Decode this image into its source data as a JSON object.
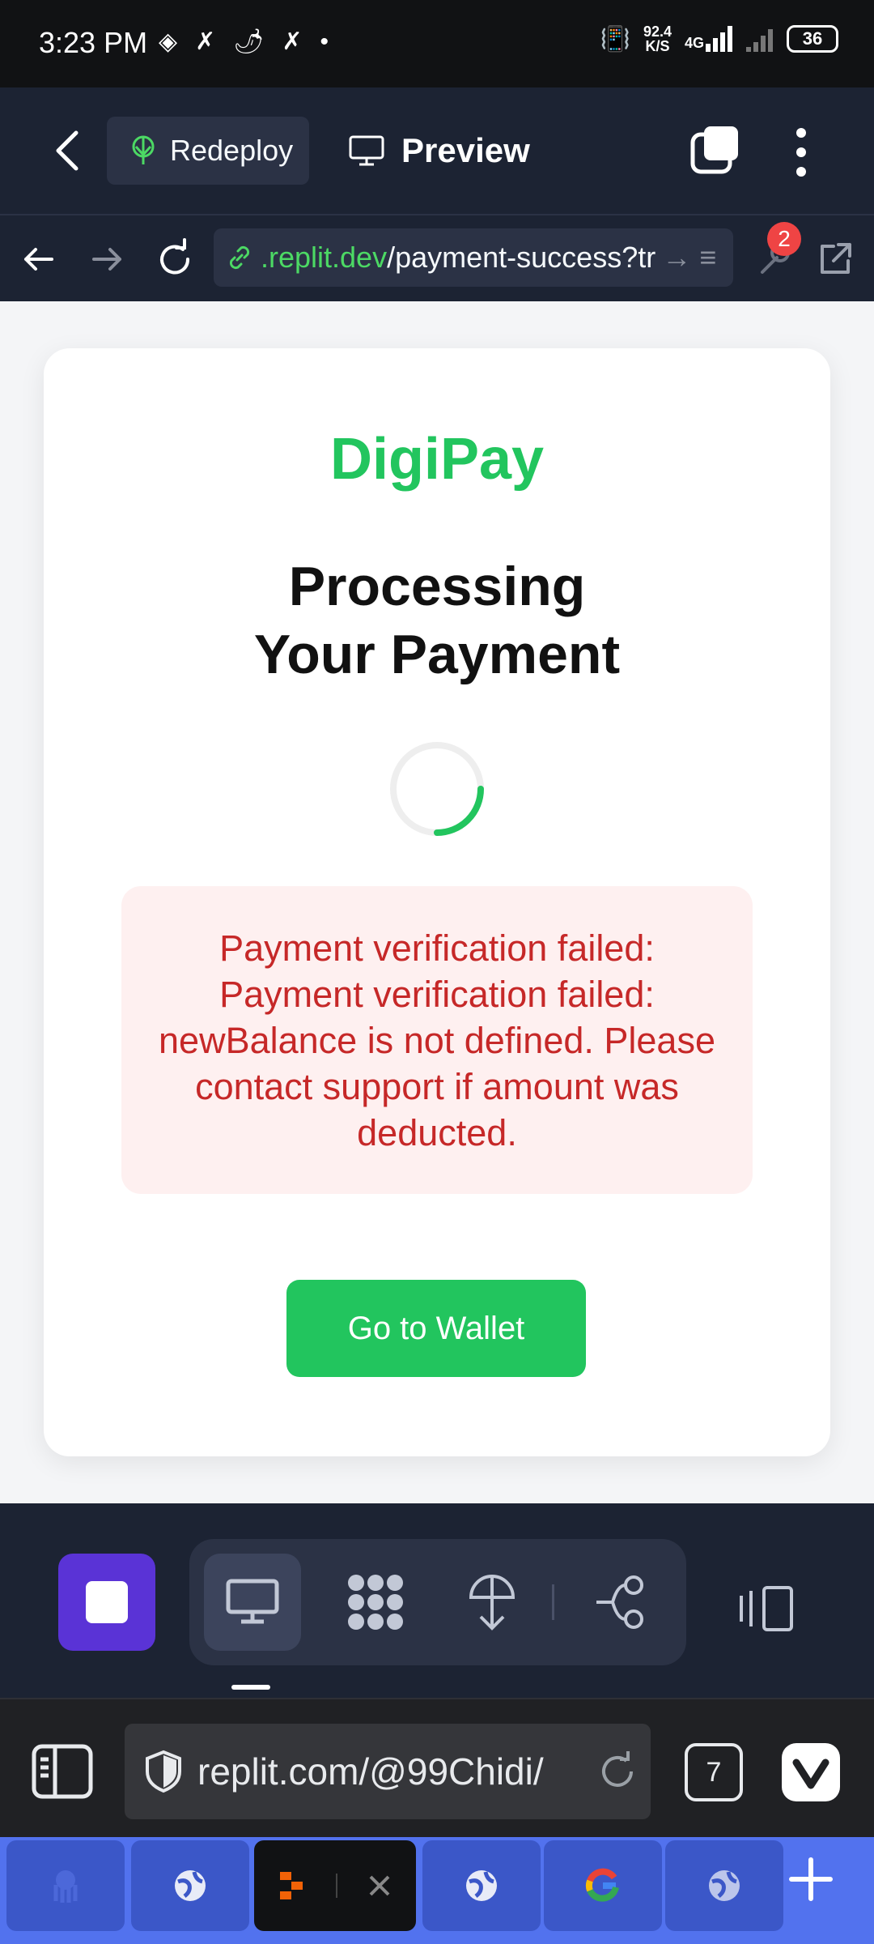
{
  "status_bar": {
    "time": "3:23 PM",
    "net_speed_value": "92.4",
    "net_speed_unit": "K/S",
    "network": "4G",
    "battery": "36"
  },
  "replit_header": {
    "redeploy_label": "Redeploy",
    "preview_label": "Preview"
  },
  "browser_bar": {
    "url_host": ".replit.dev",
    "url_path": "/payment-success?tr",
    "devtools_badge": "2"
  },
  "page": {
    "brand": "DigiPay",
    "title": "Processing Your Payment",
    "error_message": "Payment verification failed: Payment verification failed: newBalance is not defined. Please contact support if amount was deducted.",
    "wallet_button": "Go to Wallet",
    "colors": {
      "brand": "#22c55e",
      "error_text": "#c62828",
      "error_bg": "#fef0f0"
    }
  },
  "vivaldi": {
    "address": "replit.com/@99Chidi/",
    "tab_count": "7"
  }
}
